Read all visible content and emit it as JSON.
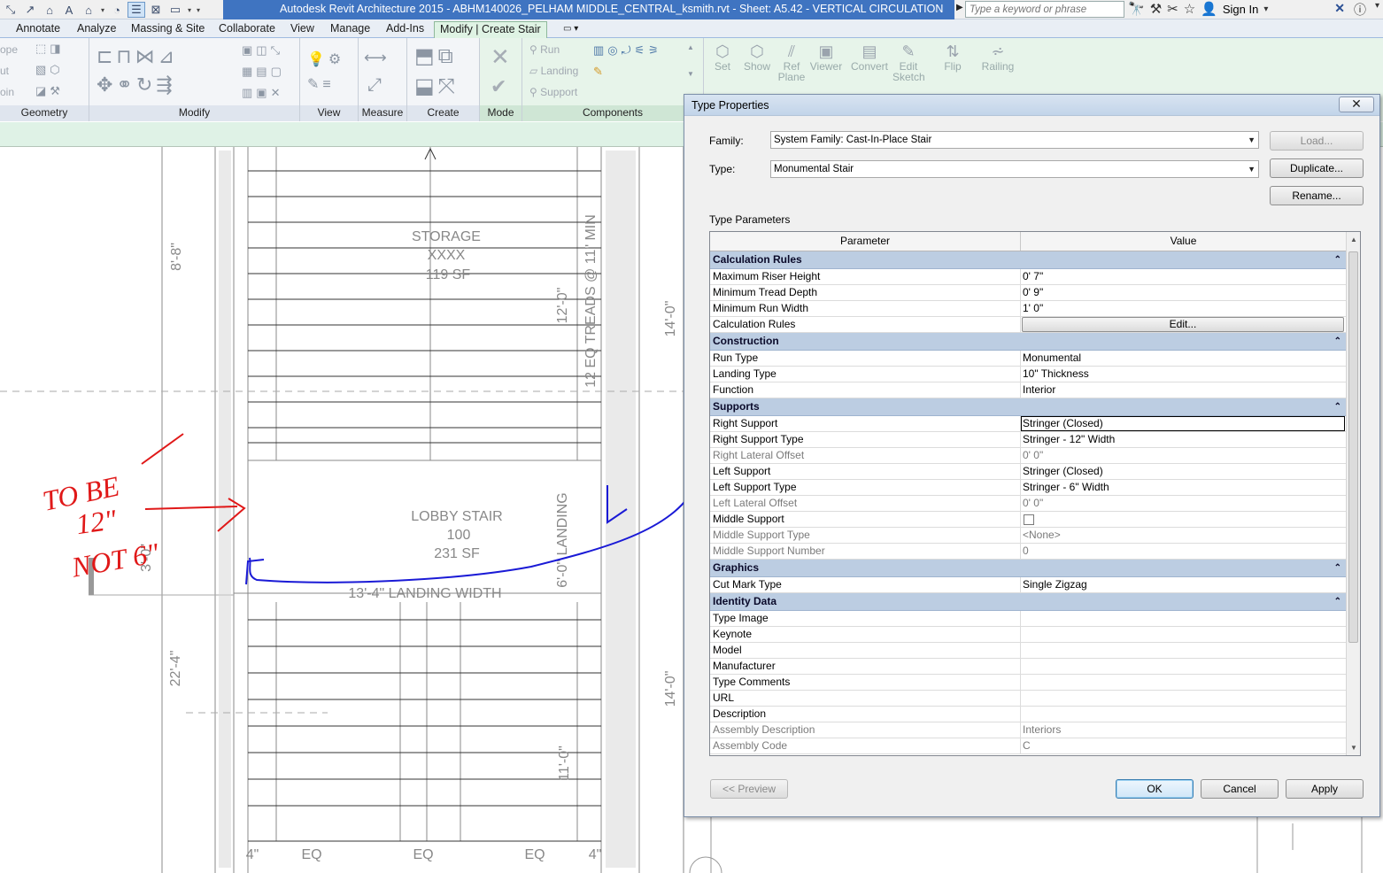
{
  "window": {
    "title": "Autodesk Revit Architecture 2015   -   ABHM140026_PELHAM MIDDLE_CENTRAL_ksmith.rvt - Sheet: A5.42 - VERTICAL CIRCULATION",
    "search_placeholder": "Type a keyword or phrase",
    "sign_in": "Sign In"
  },
  "ribbon_tabs": [
    "Annotate",
    "Analyze",
    "Massing & Site",
    "Collaborate",
    "View",
    "Manage",
    "Add-Ins",
    "Modify | Create Stair"
  ],
  "ribbon": {
    "geometry_left": [
      "ope",
      "ut",
      "oin"
    ],
    "panels": {
      "geometry": "Geometry",
      "modify": "Modify",
      "view": "View",
      "measure": "Measure",
      "create": "Create",
      "mode": "Mode",
      "components": "Components"
    },
    "components_items": [
      "Run",
      "Landing",
      "Support"
    ],
    "tools_right": [
      "Set",
      "Show",
      "Ref Plane",
      "Viewer",
      "Convert",
      "Edit Sketch",
      "Flip",
      "Railing"
    ]
  },
  "drawing": {
    "rooms": [
      {
        "name": "STORAGE",
        "number": "XXXX",
        "area": "119 SF"
      },
      {
        "name": "LOBBY STAIR",
        "number": "100",
        "area": "231 SF"
      }
    ],
    "dims": [
      "8'-8\"",
      "12'-0\"",
      "12 EQ TREADS @ 11\" MIN",
      "14'-0\"",
      "6'-0\" LANDING",
      "13'-4\" LANDING WIDTH",
      "22'-4\"",
      "14'-0\"",
      "11'-0\"",
      "EQ",
      "EQ",
      "EQ",
      "4\"",
      "4\"",
      "3'-0\""
    ],
    "markup_note": [
      "TO BE",
      "12\"",
      "NOT 6\""
    ]
  },
  "dialog": {
    "title": "Type Properties",
    "family_label": "Family:",
    "family_value": "System Family: Cast-In-Place Stair",
    "type_label": "Type:",
    "type_value": "Monumental Stair",
    "load": "Load...",
    "duplicate": "Duplicate...",
    "rename": "Rename...",
    "type_parameters": "Type Parameters",
    "col_parameter": "Parameter",
    "col_value": "Value",
    "groups": [
      {
        "name": "Calculation Rules",
        "rows": [
          [
            "Maximum Riser Height",
            "0'  7\""
          ],
          [
            "Minimum Tread Depth",
            "0'  9\""
          ],
          [
            "Minimum Run Width",
            "1'  0\""
          ],
          [
            "Calculation Rules",
            "Edit..."
          ]
        ]
      },
      {
        "name": "Construction",
        "rows": [
          [
            "Run Type",
            "Monumental"
          ],
          [
            "Landing Type",
            "10\" Thickness"
          ],
          [
            "Function",
            "Interior"
          ]
        ]
      },
      {
        "name": "Supports",
        "rows": [
          [
            "Right Support",
            "Stringer (Closed)"
          ],
          [
            "Right Support Type",
            "Stringer - 12\" Width"
          ],
          [
            "Right Lateral Offset",
            "0'  0\""
          ],
          [
            "Left Support",
            "Stringer (Closed)"
          ],
          [
            "Left Support Type",
            "Stringer - 6\" Width"
          ],
          [
            "Left Lateral Offset",
            "0'  0\""
          ],
          [
            "Middle Support",
            ""
          ],
          [
            "Middle Support Type",
            "<None>"
          ],
          [
            "Middle Support Number",
            "0"
          ]
        ]
      },
      {
        "name": "Graphics",
        "rows": [
          [
            "Cut Mark Type",
            "Single Zigzag"
          ]
        ]
      },
      {
        "name": "Identity Data",
        "rows": [
          [
            "Type Image",
            ""
          ],
          [
            "Keynote",
            ""
          ],
          [
            "Model",
            ""
          ],
          [
            "Manufacturer",
            ""
          ],
          [
            "Type Comments",
            ""
          ],
          [
            "URL",
            ""
          ],
          [
            "Description",
            ""
          ],
          [
            "Assembly Description",
            "Interiors"
          ],
          [
            "Assembly Code",
            "C"
          ]
        ]
      }
    ],
    "preview": "<< Preview",
    "ok": "OK",
    "cancel": "Cancel",
    "apply": "Apply"
  },
  "colors": {
    "title_blue": "#3f74c1",
    "group_header": "#bccde2",
    "markup_blue": "#1a1ad6",
    "markup_red": "#e01818"
  }
}
